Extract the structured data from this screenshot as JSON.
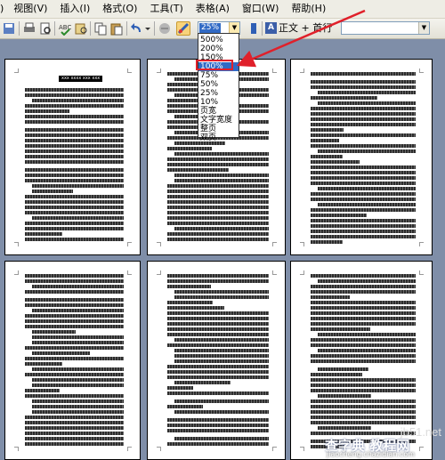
{
  "menubar": {
    "items": [
      {
        "label": "视图(V)"
      },
      {
        "label": "插入(I)"
      },
      {
        "label": "格式(O)"
      },
      {
        "label": "工具(T)"
      },
      {
        "label": "表格(A)"
      },
      {
        "label": "窗口(W)"
      },
      {
        "label": "帮助(H)"
      }
    ],
    "leading_fragment": ")"
  },
  "toolbar": {
    "zoom_value": "25%",
    "style_label": "正文 + 首行",
    "style_icon": "A"
  },
  "zoom_dropdown": {
    "options": [
      "500%",
      "200%",
      "150%",
      "100%",
      "75%",
      "50%",
      "25%",
      "10%",
      "页宽",
      "文字宽度",
      "整页",
      "双页"
    ],
    "selected": "100%"
  },
  "document": {
    "title_snippet": "xxx xxxx xxx xxx",
    "page_count_visible": 6
  },
  "watermark": {
    "domain": "jb51.net",
    "main": "查字典 教程网",
    "sub": "jiaocheng.chazidian.com"
  },
  "colors": {
    "workspace_bg": "#7f8ea8",
    "selection_blue": "#316ac5",
    "annotation_red": "#e0202a"
  }
}
